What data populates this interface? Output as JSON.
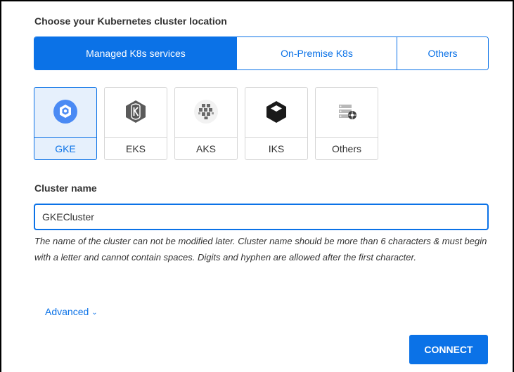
{
  "section_title": "Choose your Kubernetes cluster location",
  "location_tabs": [
    {
      "label": "Managed K8s services",
      "active": true
    },
    {
      "label": "On-Premise K8s",
      "active": false
    },
    {
      "label": "Others",
      "active": false
    }
  ],
  "providers": [
    {
      "label": "GKE",
      "icon": "gke-icon",
      "selected": true
    },
    {
      "label": "EKS",
      "icon": "eks-icon",
      "selected": false
    },
    {
      "label": "AKS",
      "icon": "aks-icon",
      "selected": false
    },
    {
      "label": "IKS",
      "icon": "iks-icon",
      "selected": false
    },
    {
      "label": "Others",
      "icon": "others-icon",
      "selected": false
    }
  ],
  "cluster_name": {
    "label": "Cluster name",
    "value": "GKECluster",
    "help": "The name of the cluster can not be modified later. Cluster name should be more than 6 characters & must begin with a letter and cannot contain spaces. Digits and hyphen are allowed after the first character."
  },
  "advanced": {
    "label": "Advanced"
  },
  "connect_button": {
    "label": "CONNECT"
  },
  "colors": {
    "accent": "#0b72e7",
    "selected_bg": "#e6f0fc",
    "border": "#d6d6d6",
    "text": "#333333"
  }
}
